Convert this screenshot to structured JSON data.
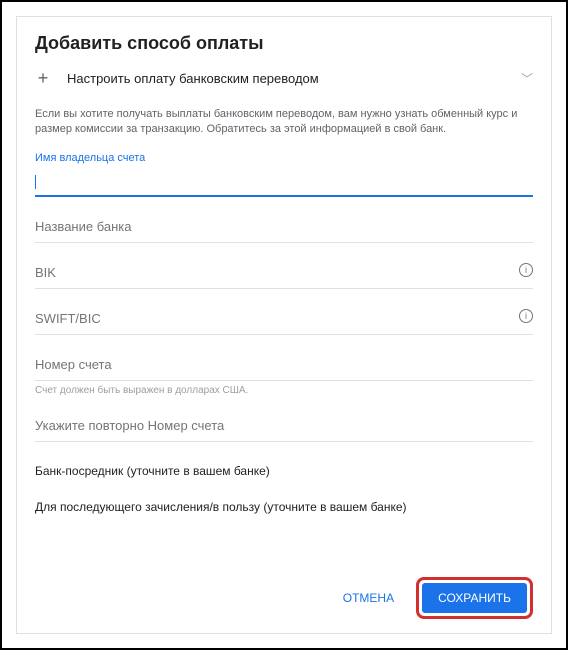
{
  "title": "Добавить способ оплаты",
  "config": {
    "label": "Настроить оплату банковским переводом"
  },
  "notice": "Если вы хотите получать выплаты банковским переводом, вам нужно узнать обменный курс и размер комиссии за транзакцию. Обратитесь за этой информацией в свой банк.",
  "fields": {
    "owner": {
      "label": "Имя владельца счета"
    },
    "bank": {
      "label": "Название банка"
    },
    "bik": {
      "label": "BIK"
    },
    "swift": {
      "label": "SWIFT/BIC"
    },
    "account": {
      "label": "Номер счета",
      "hint": "Счет должен быть выражен в долларах США."
    },
    "repeat": {
      "label": "Укажите повторно Номер счета"
    }
  },
  "sections": {
    "intermediary": "Банк-посредник (уточните в вашем банке)",
    "beneficiary": "Для последующего зачисления/в пользу (уточните в вашем банке)"
  },
  "buttons": {
    "cancel": "ОТМЕНА",
    "save": "СОХРАНИТЬ"
  }
}
